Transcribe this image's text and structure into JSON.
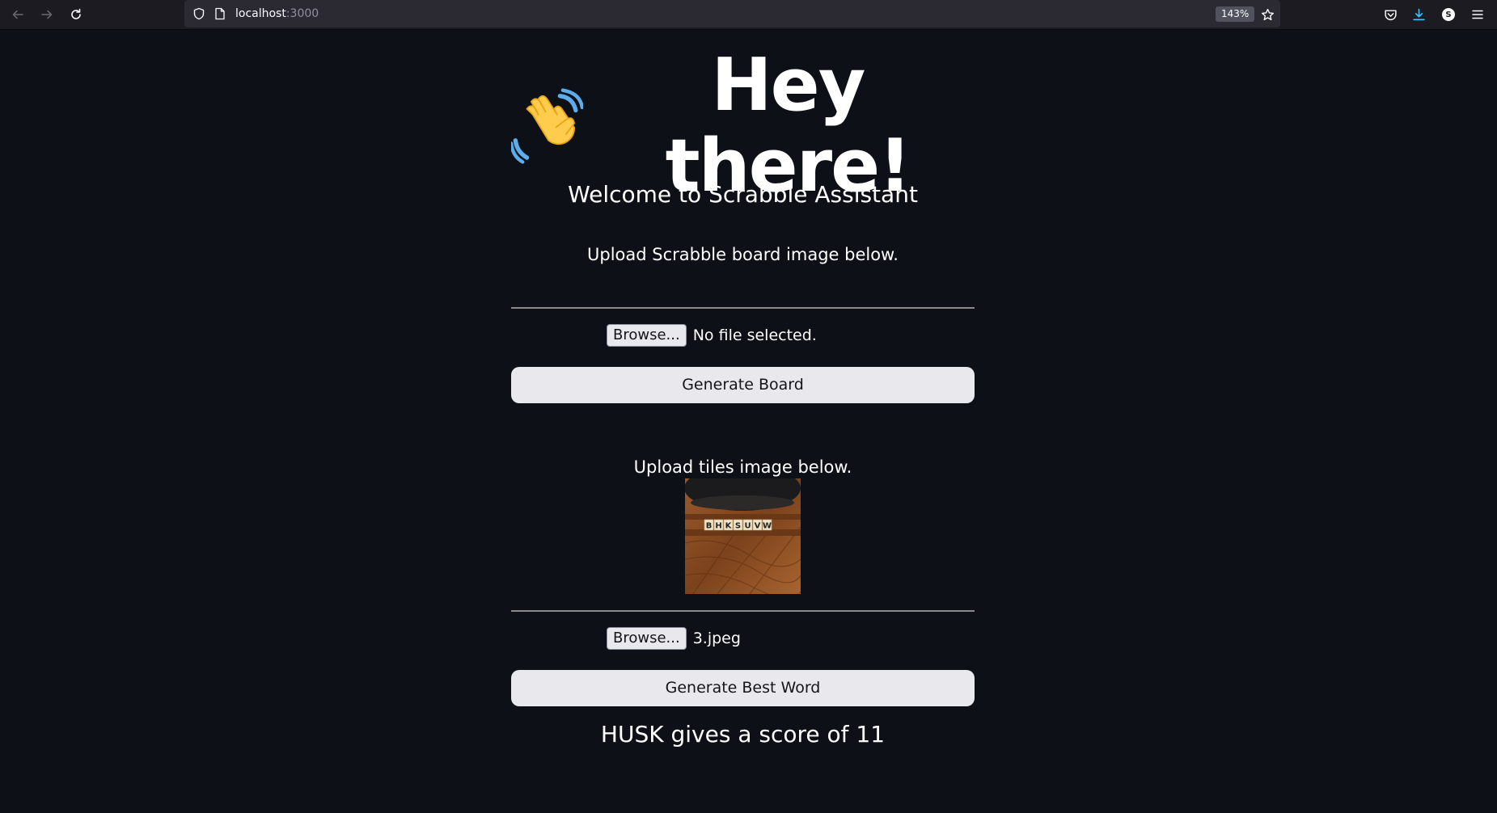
{
  "browser": {
    "url_host": "localhost",
    "url_port": ":3000",
    "zoom": "143%"
  },
  "page": {
    "hero_title": "Hey there!",
    "subtitle": "Welcome to Scrabble Assistant",
    "board_section": {
      "instruction": "Upload Scrabble board image below.",
      "browse_label": "Browse...",
      "file_status": "No file selected.",
      "button_label": "Generate Board"
    },
    "tiles_section": {
      "instruction": "Upload tiles image below.",
      "tile_letters": [
        "B",
        "H",
        "K",
        "S",
        "U",
        "V",
        "W"
      ],
      "browse_label": "Browse...",
      "file_status": "3.jpeg",
      "button_label": "Generate Best Word"
    },
    "result": "HUSK gives a score of 11"
  },
  "colors": {
    "page_background": "#0d1117",
    "toolbar_background": "#1c1b22",
    "button_background": "#e9e9ed"
  }
}
